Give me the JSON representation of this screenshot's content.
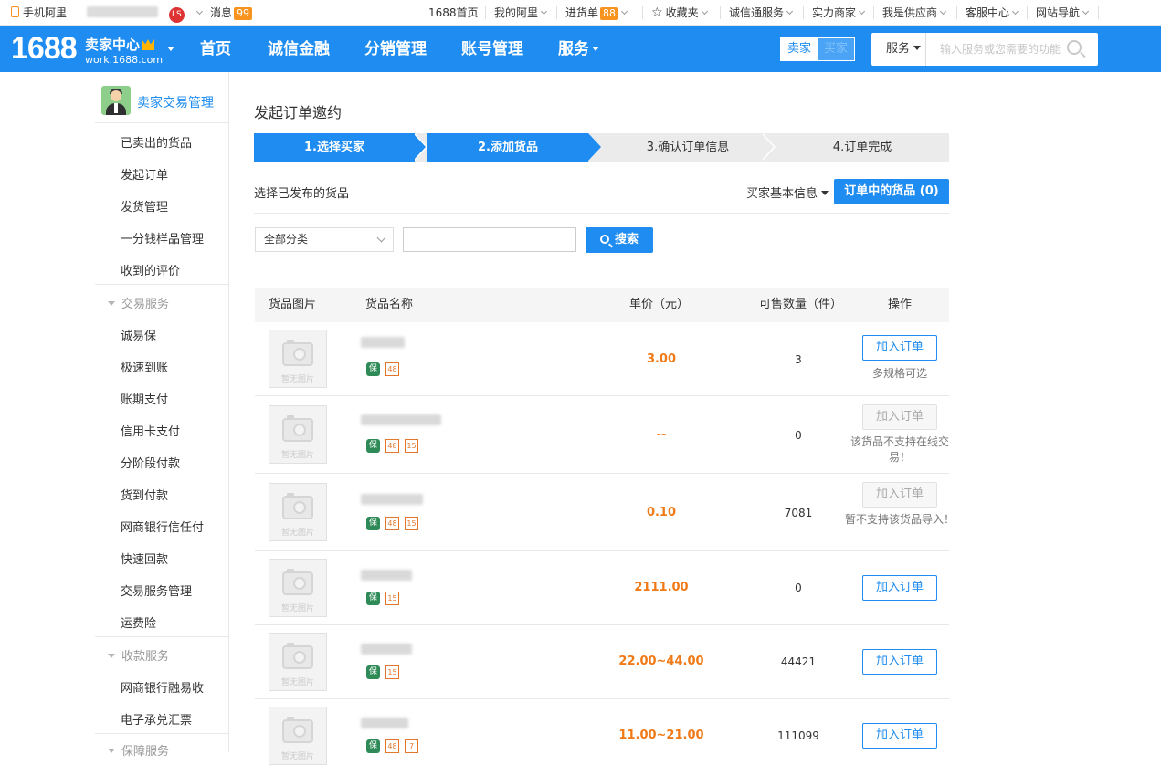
{
  "topbar": {
    "mobile_label": "手机阿里",
    "msg_label": "消息",
    "msg_count": "99",
    "user_badge": "LS",
    "items": [
      {
        "label": "1688首页"
      },
      {
        "label": "我的阿里"
      },
      {
        "label": "进货单",
        "badge": "88"
      },
      {
        "label": "收藏夹"
      },
      {
        "label": "诚信通服务"
      },
      {
        "label": "实力商家"
      },
      {
        "label": "我是供应商"
      },
      {
        "label": "客服中心"
      },
      {
        "label": "网站导航"
      }
    ]
  },
  "nav": {
    "logo_num": "1688",
    "logo_title": "卖家中心",
    "logo_sub": "work.1688.com",
    "items": [
      "首页",
      "诚信金融",
      "分销管理",
      "账号管理",
      "服务"
    ],
    "role_seller": "卖家",
    "role_buyer": "买家",
    "search_type": "服务",
    "search_placeholder": "输入服务或您需要的功能"
  },
  "sidebar": {
    "title": "卖家交易管理",
    "group1": [
      "已卖出的货品",
      "发起订单",
      "发货管理",
      "一分钱样品管理",
      "收到的评价"
    ],
    "section_trade": "交易服务",
    "group2": [
      "诚易保",
      "极速到账",
      "账期支付",
      "信用卡支付",
      "分阶段付款",
      "货到付款",
      "网商银行信任付",
      "快速回款",
      "交易服务管理",
      "运费险"
    ],
    "section_collect": "收款服务",
    "group3": [
      "网商银行融易收",
      "电子承兑汇票"
    ],
    "section_guarantee": "保障服务"
  },
  "main": {
    "page_title": "发起订单邀约",
    "steps": [
      "1.选择买家",
      "2.添加货品",
      "3.确认订单信息",
      "4.订单完成"
    ],
    "select_published": "选择已发布的货品",
    "buyer_info": "买家基本信息",
    "cart_button": "订单中的货品 (0)",
    "category": "全部分类",
    "search_button": "搜索",
    "columns": [
      "货品图片",
      "货品名称",
      "单价（元）",
      "可售数量（件）",
      "操作"
    ],
    "no_image": "暂无图片",
    "rows": [
      {
        "price": "3.00",
        "qty": "3",
        "action": "加入订单",
        "note": "多规格可选",
        "tags": [
          "保",
          "48"
        ]
      },
      {
        "price": "--",
        "qty": "0",
        "action": "加入订单",
        "note": "该货品不支持在线交易！",
        "tags": [
          "保",
          "48",
          "15"
        ]
      },
      {
        "price": "0.10",
        "qty": "7081",
        "action": "加入订单",
        "note": "暂不支持该货品导入！",
        "tags": [
          "保",
          "48",
          "15"
        ]
      },
      {
        "price": "2111.00",
        "qty": "0",
        "action": "加入订单",
        "note": "",
        "tags": [
          "保",
          "15"
        ]
      },
      {
        "price": "22.00~44.00",
        "qty": "44421",
        "action": "加入订单",
        "note": "",
        "tags": [
          "保",
          "15"
        ]
      },
      {
        "price": "11.00~21.00",
        "qty": "111099",
        "action": "加入订单",
        "note": "",
        "tags": [
          "保",
          "48",
          "7"
        ]
      }
    ]
  },
  "colors": {
    "primary": "#1e8cf0",
    "price": "#f07a17",
    "badge": "#f7931e"
  }
}
